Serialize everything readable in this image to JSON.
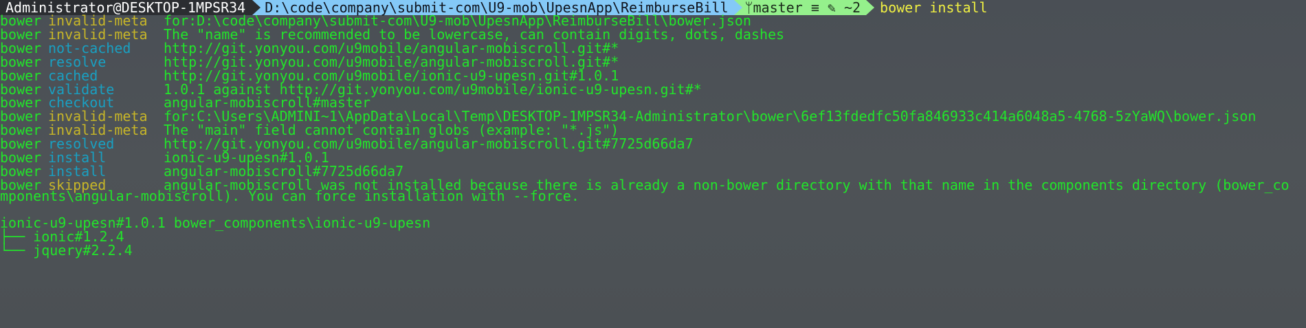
{
  "prompt": {
    "user": "Administrator@DESKTOP-1MPSR34",
    "path": "D:\\code\\company\\submit-com\\U9-mob\\UpesnApp\\ReimburseBill",
    "git": "ᛘmaster ≡ ✎ ~2",
    "command": "bower install"
  },
  "log": [
    {
      "prog": "bower",
      "action": "invalid-meta",
      "color": "#c7b628",
      "msg": "for:D:\\code\\company\\submit-com\\U9-mob\\UpesnApp\\ReimburseBill\\bower.json"
    },
    {
      "prog": "bower",
      "action": "invalid-meta",
      "color": "#c7b628",
      "msg": "The \"name\" is recommended to be lowercase, can contain digits, dots, dashes"
    },
    {
      "prog": "bower",
      "action": "not-cached",
      "color": "#19a0c2",
      "msg": "http://git.yonyou.com/u9mobile/angular-mobiscroll.git#*"
    },
    {
      "prog": "bower",
      "action": "resolve",
      "color": "#19a0c2",
      "msg": "http://git.yonyou.com/u9mobile/angular-mobiscroll.git#*"
    },
    {
      "prog": "bower",
      "action": "cached",
      "color": "#19a0c2",
      "msg": "http://git.yonyou.com/u9mobile/ionic-u9-upesn.git#1.0.1"
    },
    {
      "prog": "bower",
      "action": "validate",
      "color": "#19a0c2",
      "msg": "1.0.1 against http://git.yonyou.com/u9mobile/ionic-u9-upesn.git#*"
    },
    {
      "prog": "bower",
      "action": "checkout",
      "color": "#19a0c2",
      "msg": "angular-mobiscroll#master"
    },
    {
      "prog": "bower",
      "action": "invalid-meta",
      "color": "#c7b628",
      "msg": "for:C:\\Users\\ADMINI~1\\AppData\\Local\\Temp\\DESKTOP-1MPSR34-Administrator\\bower\\6ef13fdedfc50fa846933c414a6048a5-4768-5zYaWQ\\bower.json"
    },
    {
      "prog": "bower",
      "action": "invalid-meta",
      "color": "#c7b628",
      "msg": "The \"main\" field cannot contain globs (example: \"*.js\")"
    },
    {
      "prog": "bower",
      "action": "resolved",
      "color": "#19a0c2",
      "msg": "http://git.yonyou.com/u9mobile/angular-mobiscroll.git#7725d66da7"
    },
    {
      "prog": "bower",
      "action": "install",
      "color": "#19a0c2",
      "msg": "ionic-u9-upesn#1.0.1"
    },
    {
      "prog": "bower",
      "action": "install",
      "color": "#19a0c2",
      "msg": "angular-mobiscroll#7725d66da7"
    },
    {
      "prog": "bower",
      "action": "skipped",
      "color": "#c7b628",
      "msg": "angular-mobiscroll was not installed because there is already a non-bower directory with that name in the components directory (bower_co"
    }
  ],
  "wrap_line": "mponents\\angular-mobiscroll). You can force installation with --force.",
  "summary": "ionic-u9-upesn#1.0.1 bower_components\\ionic-u9-upesn",
  "tree": [
    {
      "glyph": "├── ",
      "text": "ionic#1.2.4"
    },
    {
      "glyph": "└── ",
      "text": "jquery#2.2.4"
    }
  ],
  "colors": {
    "text_green": "#22e52a",
    "warn_yellow": "#c7b628",
    "info_cyan": "#19a0c2",
    "prompt_path_bg": "#84c9f7",
    "prompt_git_bg": "#95f08c",
    "command_yellow": "#f0f042"
  }
}
